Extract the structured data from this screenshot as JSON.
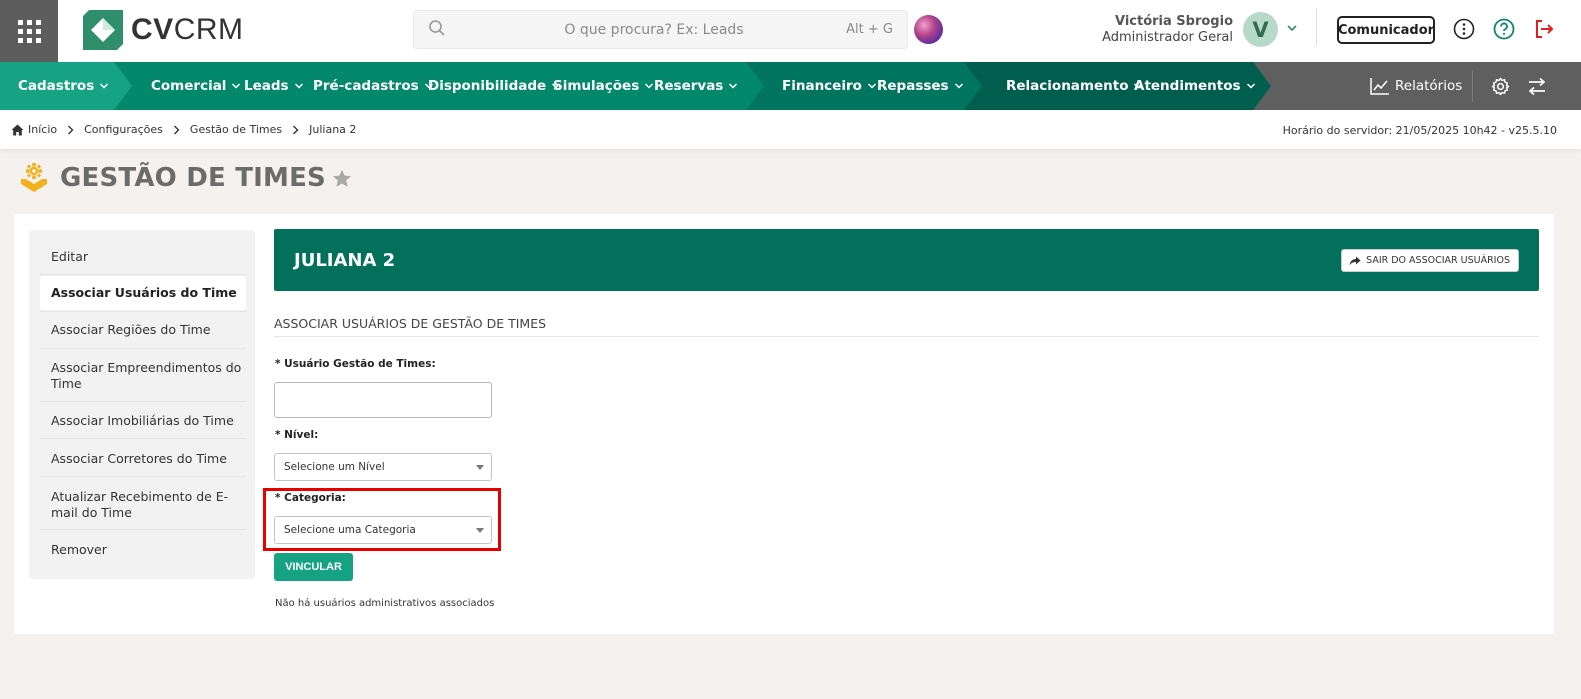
{
  "app": {
    "brand_bold": "CV",
    "brand_light": "CRM"
  },
  "search": {
    "placeholder": "O que procura? Ex: Leads",
    "shortcut": "Alt + G"
  },
  "user": {
    "name": "Victória Sbrogio",
    "role": "Administrador Geral",
    "avatar_letter": "V"
  },
  "header": {
    "communicator_label": "Comunicador"
  },
  "nav": {
    "items": [
      "Cadastros",
      "Comercial",
      "Leads",
      "Pré-cadastros",
      "Disponibilidade",
      "Simulações",
      "Reservas",
      "Financeiro",
      "Repasses",
      "Relacionamento",
      "Atendimentos"
    ],
    "reports_label": "Relatórios"
  },
  "breadcrumb": {
    "items": [
      "Início",
      "Configurações",
      "Gestão de Times",
      "Juliana 2"
    ]
  },
  "server_time": "Horário do servidor: 21/05/2025 10h42 - v25.5.10",
  "page": {
    "title": "GESTÃO DE TIMES"
  },
  "sidebar": {
    "items": [
      {
        "label": "Editar"
      },
      {
        "label": "Associar Usuários do Time"
      },
      {
        "label": "Associar Regiões do Time"
      },
      {
        "label": "Associar Empreendimentos do Time"
      },
      {
        "label": "Associar Imobiliárias do Time"
      },
      {
        "label": "Associar Corretores do Time"
      },
      {
        "label": "Atualizar Recebimento de E-mail do Time"
      },
      {
        "label": "Remover"
      }
    ]
  },
  "main": {
    "banner_title": "JULIANA 2",
    "exit_button": "SAIR DO ASSOCIAR USUÁRIOS",
    "section_title": "ASSOCIAR USUÁRIOS DE GESTÃO DE TIMES",
    "user_label": "* Usuário Gestão de Times:",
    "user_value": "",
    "level_label": "* Nível:",
    "level_value": "Selecione um Nível",
    "category_label": "* Categoria:",
    "category_value": "Selecione uma Categoria",
    "submit_label": "VINCULAR",
    "empty_message": "Não há usuários administrativos associados"
  },
  "colors": {
    "brand_green": "#16a383",
    "dark_green": "#02705a",
    "highlight": "#e60000",
    "logout_red": "#e02020"
  }
}
